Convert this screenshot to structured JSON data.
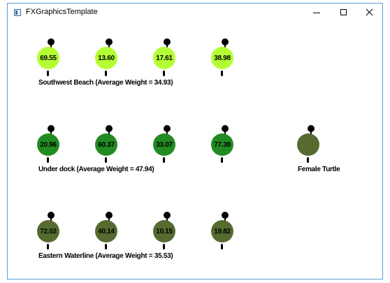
{
  "window": {
    "title": "FXGraphicsTemplate"
  },
  "colors": {
    "beach": "#b3ff33",
    "dock": "#228b22",
    "waterline": "#556b2f",
    "female": "#556b2f"
  },
  "groups": [
    {
      "label": "Southwest Beach (Average Weight = 34.93)",
      "color": "beach",
      "weights": [
        "69.55",
        "13.60",
        "17.61",
        "38.98"
      ]
    },
    {
      "label": "Under dock (Average Weight = 47.94)",
      "color": "dock",
      "weights": [
        "20.96",
        "60.37",
        "33.07",
        "77.38"
      ]
    },
    {
      "label": "Eastern Waterline (Average Weight = 35.53)",
      "color": "waterline",
      "weights": [
        "72.02",
        "40.14",
        "10.15",
        "19.82"
      ]
    }
  ],
  "female_turtle": {
    "label": "Female Turtle"
  }
}
